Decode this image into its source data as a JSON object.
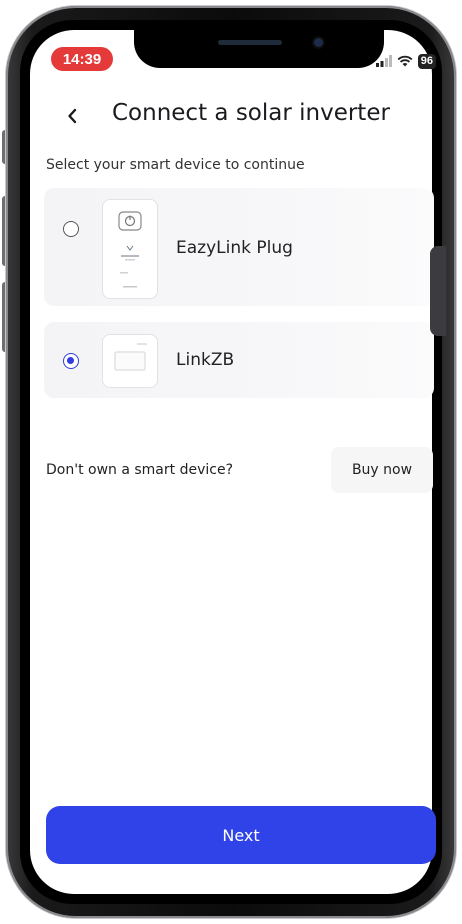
{
  "status_bar": {
    "time": "14:39",
    "battery": "96",
    "signal_icon": "signal-icon",
    "wifi_icon": "wifi-icon"
  },
  "header": {
    "back_icon": "chevron-left-icon",
    "title": "Connect a solar inverter"
  },
  "subtitle": "Select your smart device to continue",
  "devices": [
    {
      "label": "EazyLink Plug",
      "selected": false
    },
    {
      "label": "LinkZB",
      "selected": true
    }
  ],
  "buy": {
    "prompt": "Don't own a smart device?",
    "button_label": "Buy now"
  },
  "next_button": "Next",
  "colors": {
    "accent": "#2f43e8",
    "time_pill": "#e53a3a"
  }
}
